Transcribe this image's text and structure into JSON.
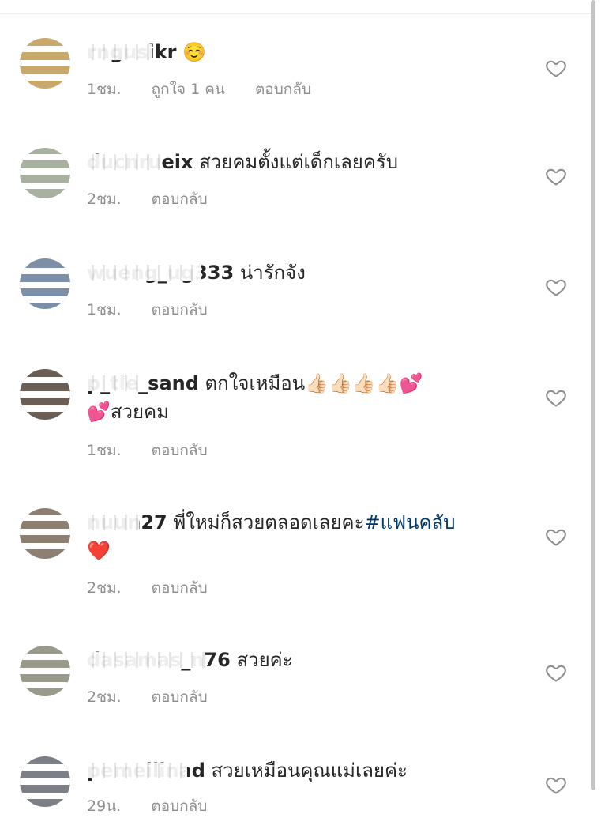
{
  "comments": [
    {
      "user": "rngusikr",
      "text": "☺️",
      "time": "1ชม.",
      "likes": "ถูกใจ 1 คน",
      "reply": "ตอบกลับ"
    },
    {
      "user": "ducnrueix",
      "text": "สวยคมตั้งแต่เด็กเลยครับ",
      "time": "2ชม.",
      "reply": "ตอบกลับ"
    },
    {
      "user": "wueng_ug333",
      "text": "น่ารักจัง",
      "time": "1ชม.",
      "reply": "ตอบกลับ"
    },
    {
      "user": "p_tle_sand",
      "text": "ตกใจเหมือน👍🏻👍🏻👍🏻👍🏻💕",
      "text2": "💕สวยคม",
      "time": "1ชม.",
      "reply": "ตอบกลับ"
    },
    {
      "user": "nuun27",
      "text": "พี่ใหม่ก็สวยตลอดเลยคะ",
      "hashtag": "#แฟนคลับ",
      "text2": "❤️",
      "time": "2ชม.",
      "reply": "ตอบกลับ"
    },
    {
      "user": "dasamas_n76",
      "text": "สวยค่ะ",
      "time": "2ชม.",
      "reply": "ตอบกลับ"
    },
    {
      "user": "pemeilinad",
      "text": "สวยเหมือนคุณแม่เลยค่ะ",
      "time": "29น.",
      "reply": "ตอบกลับ"
    }
  ],
  "icons": {
    "like": "heart-outline-icon"
  },
  "colors": {
    "text": "#262626",
    "meta": "#8e8e8e",
    "hashtag": "#00376b"
  }
}
